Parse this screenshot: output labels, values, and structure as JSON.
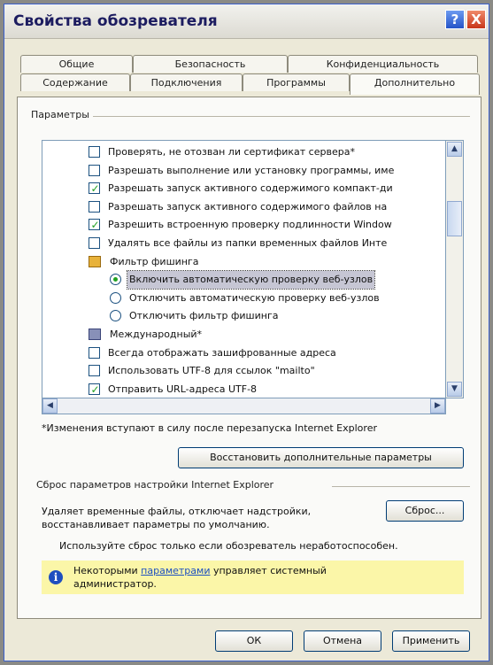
{
  "window": {
    "title": "Свойства обозревателя",
    "help_glyph": "?",
    "close_glyph": "X"
  },
  "tabs_back": [
    "Общие",
    "Безопасность",
    "Конфиденциальность"
  ],
  "tabs_front": [
    "Содержание",
    "Подключения",
    "Программы",
    "Дополнительно"
  ],
  "active_tab": "Дополнительно",
  "params": {
    "group_label": "Параметры",
    "items": [
      {
        "type": "checkbox",
        "checked": false,
        "label": "Проверять, не отозван ли сертификат сервера*"
      },
      {
        "type": "checkbox",
        "checked": false,
        "label": "Разрешать выполнение или установку программы, име"
      },
      {
        "type": "checkbox",
        "checked": true,
        "label": "Разрешать запуск активного содержимого компакт-ди"
      },
      {
        "type": "checkbox",
        "checked": false,
        "label": "Разрешать запуск активного содержимого файлов на"
      },
      {
        "type": "checkbox",
        "checked": true,
        "label": "Разрешить встроенную проверку подлинности Window"
      },
      {
        "type": "checkbox",
        "checked": false,
        "label": "Удалять все файлы из папки временных файлов Инте"
      },
      {
        "type": "group",
        "icon": "lock-folder-icon",
        "label": "Фильтр фишинга"
      },
      {
        "type": "radio",
        "checked": true,
        "selected": true,
        "label": "Включить автоматическую проверку веб-узлов"
      },
      {
        "type": "radio",
        "checked": false,
        "label": "Отключить автоматическую проверку веб-узлов"
      },
      {
        "type": "radio",
        "checked": false,
        "label": "Отключить фильтр фишинга"
      },
      {
        "type": "group",
        "icon": "globe-folder-icon",
        "label": "Международный*"
      },
      {
        "type": "checkbox",
        "checked": false,
        "label": "Всегда отображать зашифрованные адреса"
      },
      {
        "type": "checkbox",
        "checked": false,
        "label": "Использовать UTF-8 для ссылок \"mailto\""
      },
      {
        "type": "checkbox",
        "checked": true,
        "label": "Отправить URL-адреса UTF-8"
      }
    ]
  },
  "restart_note": "*Изменения вступают в силу после перезапуска Internet Explorer",
  "restore_button": "Восстановить дополнительные параметры",
  "reset": {
    "group_label": "Сброс параметров настройки Internet Explorer",
    "description_lines": [
      "Удаляет временные файлы, отключает надстройки,",
      "восстанавливает параметры по умолчанию."
    ],
    "button": "Сброс...",
    "use_note": "Используйте сброс только если обозреватель неработоспособен."
  },
  "info": {
    "before_link": "Некоторыми ",
    "link": "параметрами",
    "after_link": " управляет системный",
    "line2": "администратор."
  },
  "footer": {
    "ok": "ОК",
    "cancel": "Отмена",
    "apply": "Применить"
  }
}
